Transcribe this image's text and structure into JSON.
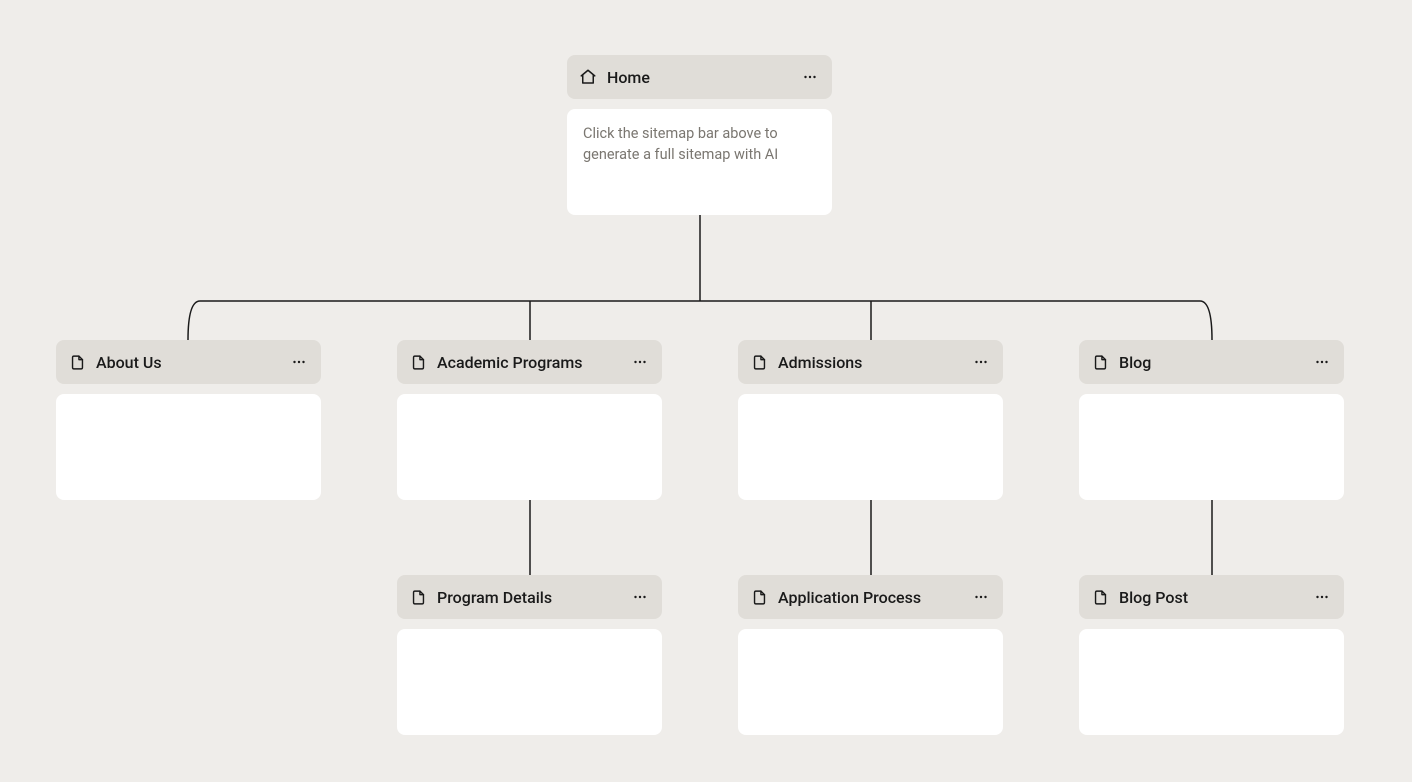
{
  "root": {
    "title": "Home",
    "hint": "Click the sitemap bar above to generate a full sitemap with AI"
  },
  "children": [
    {
      "title": "About Us"
    },
    {
      "title": "Academic Programs",
      "child": {
        "title": "Program Details"
      }
    },
    {
      "title": "Admissions",
      "child": {
        "title": "Application Process"
      }
    },
    {
      "title": "Blog",
      "child": {
        "title": "Blog Post"
      }
    }
  ],
  "colors": {
    "bg": "#efedea",
    "header": "#e0ddd8",
    "card": "#ffffff",
    "line": "#1a1a1a",
    "text": "#1a1a1a",
    "muted": "#7a7670"
  }
}
